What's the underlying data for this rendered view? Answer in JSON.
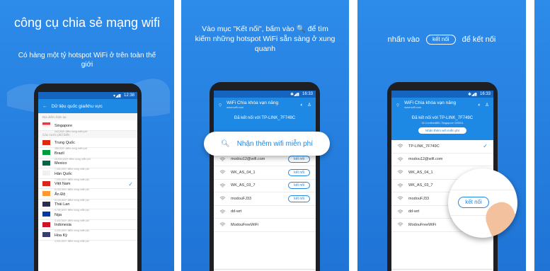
{
  "colors": {
    "brand": "#1f74d6",
    "accent": "#1e88e5",
    "check": "#1e88e5"
  },
  "panel1": {
    "title": "công cụ chia sẻ mạng wifi",
    "subtitle": "Có hàng một tỷ hotspot WiFi ở trên toàn thế giới",
    "phone": {
      "status": "12:38",
      "appbar_title": "Dữ liệu quốc gia/khu vực",
      "section_current": "Địa điểm hiện tại",
      "section_popular": "Các nước phổ biến",
      "current": {
        "name": "Singapore",
        "hotspots": "343,000+ điểm nóng miễn phí"
      },
      "countries": [
        {
          "name": "Trung Quốc",
          "hotspots": "280,000+ điểm nóng miễn phí",
          "flag": "#de2910"
        },
        {
          "name": "Brazil",
          "hotspots": "15,000,000+ điểm nóng miễn phí",
          "flag": "#009c3b"
        },
        {
          "name": "Mexico",
          "hotspots": "7,000,000+ điểm nóng miễn phí",
          "flag": "#006847"
        },
        {
          "name": "Hàn Quốc",
          "hotspots": "7,200,000+ điểm nóng miễn phí",
          "flag": "#f0f0f0"
        },
        {
          "name": "Việt Nam",
          "hotspots": "6,100,000+ điểm nóng miễn phí",
          "flag": "#da251d"
        },
        {
          "name": "Ấn Độ",
          "hotspots": "5,100,000+ điểm nóng miễn phí",
          "flag": "#ff9933"
        },
        {
          "name": "Thái Lan",
          "hotspots": "4,700,000+ điểm nóng miễn phí",
          "flag": "#2d2a4a"
        },
        {
          "name": "Nga",
          "hotspots": "4,440,000+ điểm nóng miễn phí",
          "flag": "#0039a6"
        },
        {
          "name": "Indonesia",
          "hotspots": "4,200,000+ điểm nóng miễn phí",
          "flag": "#ce1126"
        },
        {
          "name": "Hoa Kỳ",
          "hotspots": "4,000,000+ điểm nóng miễn phí",
          "flag": "#3c3b6e"
        }
      ]
    }
  },
  "panel2": {
    "caption": "Vào mục \"Kết nối\", bấm vào 🔍 để tìm kiếm những hotspot WiFi sẵn sàng ở xung quanh",
    "phone": {
      "status": "16:33",
      "appbar_title": "WiFi Chìa khóa vạn năng",
      "appbar_sub": "www.wifi.com",
      "connected": "Đã kết nối với TP-LINK_7F749C",
      "search_label": "Nhận thêm wifi miễn phí",
      "networks": [
        {
          "name": "TP-LINK_7F749C",
          "action": ""
        },
        {
          "name": "modou12@wifi.com",
          "action": "kết nối"
        },
        {
          "name": "WK_AS_04_1",
          "action": "kết nối"
        },
        {
          "name": "WK_AS_03_7",
          "action": "kết nối"
        },
        {
          "name": "modouFJ33",
          "action": "kết nối"
        },
        {
          "name": "dd-wrt",
          "action": ""
        },
        {
          "name": "ModouFreeWiFi",
          "action": ""
        }
      ]
    }
  },
  "panel3": {
    "caption_pre": "nhấn vào",
    "caption_pill": "kết nối",
    "caption_post": "để kết nối",
    "phone": {
      "status": "16:33",
      "appbar_title": "WiFi Chìa khóa vạn năng",
      "appbar_sub": "www.wifi.com",
      "connected": "Đã kết nối với TP-LINK_7F749C",
      "connected_sub": "16 Confined8KL Singapore 229501",
      "search_label": "Nhận thêm wifi miễn phí",
      "networks": [
        {
          "name": "TP-LINK_7F749C",
          "action": ""
        },
        {
          "name": "modou12@wifi.com",
          "action": ""
        },
        {
          "name": "WK_AS_04_1",
          "action": ""
        },
        {
          "name": "WK_AS_03_7",
          "action": ""
        },
        {
          "name": "modouFJ33",
          "action": ""
        },
        {
          "name": "dd-wrt",
          "action": ""
        },
        {
          "name": "ModouFreeWiFi",
          "action": ""
        }
      ],
      "magnified_button": "kết nối"
    }
  }
}
